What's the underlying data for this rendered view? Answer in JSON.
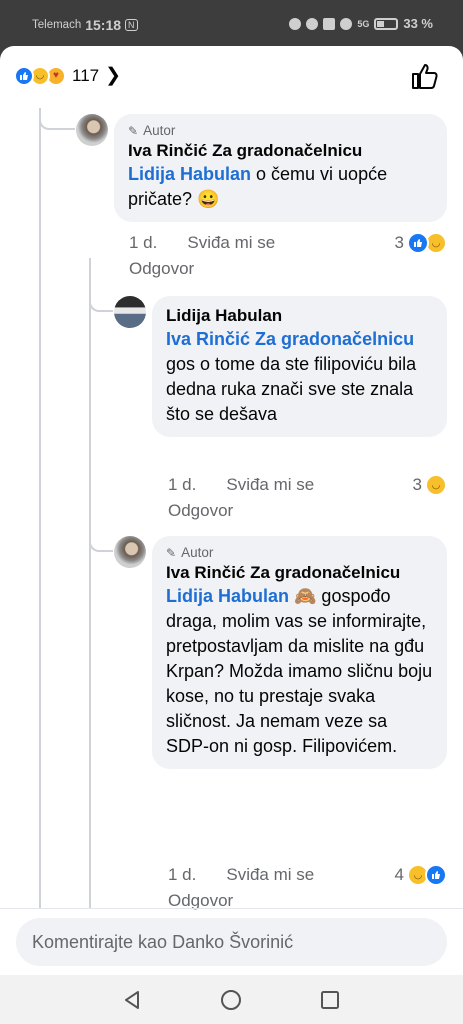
{
  "status": {
    "carrier": "Telemach",
    "time": "15:18",
    "nfc": "N",
    "battery": "33 %",
    "signal_label": "5G"
  },
  "header": {
    "reaction_count": "117",
    "reaction_icons": [
      "like-icon",
      "haha-icon",
      "care-icon"
    ]
  },
  "comments": [
    {
      "author_badge": "Autor",
      "name": "Iva Rinčić Za gradonačelnicu",
      "mention": "Lidija Habulan",
      "text": " o čemu vi uopće pričate? 😀",
      "age": "1 d.",
      "like_label": "Sviđa mi se",
      "reply_label": "Odgovor",
      "reaction_count": "3"
    },
    {
      "name": "Lidija Habulan",
      "mention": "Iva Rinčić Za gradonačelnicu",
      "text": " gos o tome da ste filipoviću bila dedna ruka znači sve ste znala što se dešava",
      "age": "1 d.",
      "like_label": "Sviđa mi se",
      "reply_label": "Odgovor",
      "reaction_count": "3"
    },
    {
      "author_badge": "Autor",
      "name": "Iva Rinčić Za gradonačelnicu",
      "mention": "Lidija Habulan",
      "text": " 🙈 gospođo draga, molim vas se informirajte, pretpostavljam da mislite na gđu Krpan? Možda imamo sličnu boju kose, no tu prestaje svaka sličnost. Ja nemam veze sa SDP-on ni gosp. Filipovićem.",
      "age": "1 d.",
      "like_label": "Sviđa mi se",
      "reply_label": "Odgovor",
      "reaction_count": "4"
    }
  ],
  "composer": {
    "placeholder": "Komentirajte kao Danko Švorinić"
  },
  "colors": {
    "accent": "#1877f2",
    "mention": "#1e6ed4",
    "bubble": "#f0f2f5",
    "muted": "#65676b"
  }
}
